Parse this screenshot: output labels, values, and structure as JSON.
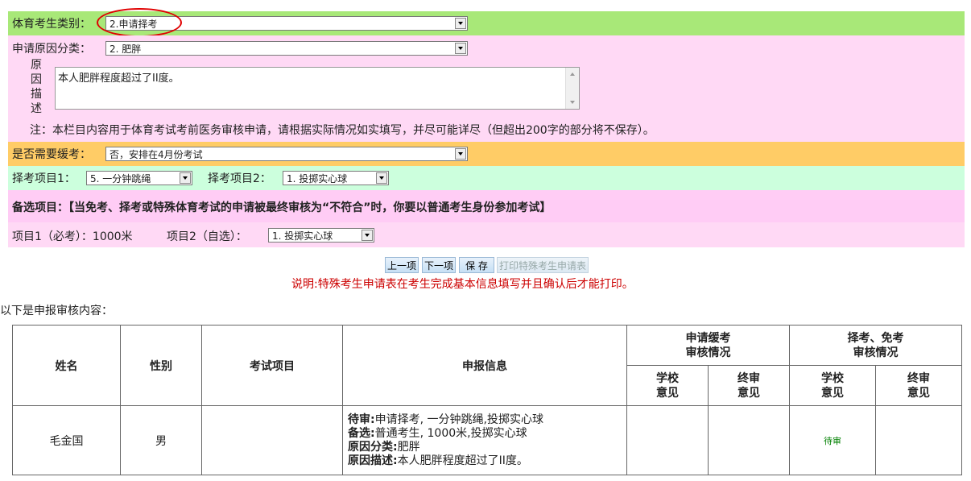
{
  "category": {
    "label": "体育考生类别：",
    "value": "2.申请择考"
  },
  "reason": {
    "label": "申请原因分类：",
    "value": "2. 肥胖",
    "desc_label": [
      "原",
      "因",
      "描",
      "述"
    ],
    "desc_text": "本人肥胖程度超过了II度。",
    "note": "注：本栏目内容用于体育考试考前医务审核申请，请根据实际情况如实填写，并尽可能详尽（但超出200字的部分将不保存）。"
  },
  "defer": {
    "label": "是否需要缓考：",
    "value": "否，安排在4月份考试"
  },
  "choose": {
    "item1_label": "择考项目1：",
    "item1_value": "5. 一分钟跳绳",
    "item2_label": "择考项目2：",
    "item2_value": "1. 投掷实心球"
  },
  "backup": {
    "title": "备选项目：",
    "text": "【当免考、择考或特殊体育考试的申请被最终审核为“不符合”时，你要以普通考生身份参加考试】"
  },
  "items": {
    "item1_label": "项目1（必考）：1000米",
    "item2_label": "项目2（自选）：",
    "item2_value": "1. 投掷实心球"
  },
  "buttons": {
    "prev": "上一项",
    "next": "下一项",
    "save": "保 存",
    "print": "打印特殊考生申请表"
  },
  "note_red": "说明:特殊考生申请表在考生完成基本信息填写并且确认后才能打印。",
  "review_title": "以下是申报审核内容：",
  "table": {
    "h_name": "姓名",
    "h_gender": "性别",
    "h_exam": "考试项目",
    "h_info": "申报信息",
    "h_defer": "申请缓考\n审核情况",
    "h_choose": "择考、免考\n审核情况",
    "h_school": "学校\n意见",
    "h_final": "终审\n意见",
    "h_school2": "学校\n意见",
    "h_final2": "终审\n意见",
    "row": {
      "name": "毛金国",
      "gender": "男",
      "info_l1k": "待审:",
      "info_l1v": "申请择考, 一分钟跳绳,投掷实心球",
      "info_l2k": "备选:",
      "info_l2v": "普通考生, 1000米,投掷实心球",
      "info_l3k": "原因分类:",
      "info_l3v": "肥胖",
      "info_l4k": "原因描述:",
      "info_l4v": "本人肥胖程度超过了II度。",
      "choose_school": "待审"
    }
  },
  "colors": {
    "green": "#a8e878",
    "pink": "#ffd9f5",
    "orange": "#ffcc66",
    "mint": "#ccffdd",
    "red": "#cc0000"
  }
}
